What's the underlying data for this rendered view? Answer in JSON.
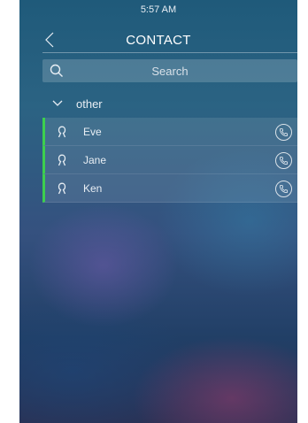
{
  "status_bar": {
    "time": "5:57 AM"
  },
  "header": {
    "title": "CONTACT",
    "back_icon": "chevron-left-icon"
  },
  "search": {
    "placeholder": "Search",
    "value": "",
    "icon": "search-icon"
  },
  "group": {
    "label": "other",
    "expanded": true,
    "icon": "chevron-down-icon"
  },
  "contacts": [
    {
      "name": "Eve",
      "icon": "person-icon",
      "action_icon": "phone-icon"
    },
    {
      "name": "Jane",
      "icon": "person-icon",
      "action_icon": "phone-icon"
    },
    {
      "name": "Ken",
      "icon": "person-icon",
      "action_icon": "phone-icon"
    }
  ],
  "colors": {
    "accent": "#3ccf4e",
    "text": "#e8eef4"
  }
}
